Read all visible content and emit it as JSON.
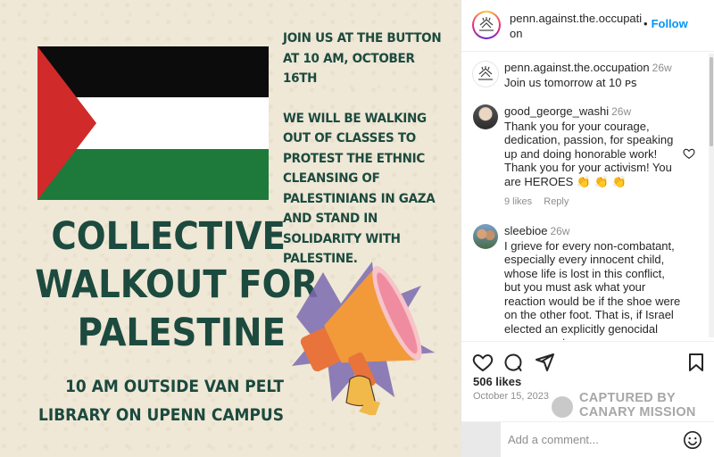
{
  "poster": {
    "right_text_1": "JOIN US  AT THE BUTTON AT 10 AM, OCTOBER 16TH",
    "right_text_2": "WE WILL BE WALKING OUT OF CLASSES TO PROTEST THE ETHNIC CLEANSING OF PALESTINIANS IN GAZA AND STAND IN SOLIDARITY WITH PALESTINE.",
    "headline_line1": "COLLECTIVE",
    "headline_line2": "WALKOUT FOR",
    "headline_line3": "PALESTINE",
    "sub_line1": "10 AM OUTSIDE VAN PELT",
    "sub_line2": "LIBRARY ON UPENN CAMPUS",
    "colors": {
      "text": "#1c4a3f",
      "background": "#efe8d6",
      "flag_red": "#d12a2a",
      "flag_green": "#1e7a3b"
    }
  },
  "header": {
    "username": "penn.against.the.occupation",
    "separator": "•",
    "follow_label": "Follow",
    "more_icon": "more-horizontal-icon"
  },
  "comments": [
    {
      "username": "penn.against.the.occupation",
      "time": "26w",
      "text": "Join us tomorrow at 10 ᴘꜱ"
    },
    {
      "username": "good_george_washi",
      "time": "26w",
      "text": "Thank you for your courage, dedication, passion, for speaking up and doing honorable work! Thank you for your activism! You are HEROES 👏 👏 👏",
      "likes": "9 likes",
      "reply": "Reply"
    },
    {
      "username": "sleebioe",
      "time": "26w",
      "text": "I grieve for every non-combatant, especially every innocent child, whose life is lost in this conflict, but you must ask what your reaction would be if the shoe were on the other foot. That is, if Israel elected an explicitly genocidal government,"
    }
  ],
  "post": {
    "likes": "506 likes",
    "date": "October 15, 2023",
    "add_comment_placeholder": "Add a comment..."
  },
  "watermark": {
    "line1": "CAPTURED BY",
    "line2": "CANARY MISSION"
  },
  "accent_color": "#0095f6"
}
